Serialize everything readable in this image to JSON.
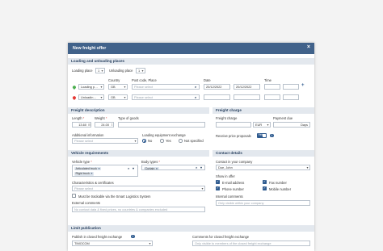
{
  "dialog": {
    "title": "New freight offer"
  },
  "loading": {
    "section": "Loading and unloading places",
    "loading_place_label": "Loading place",
    "loading_place_count": "1",
    "unloading_place_label": "Unloading place",
    "unloading_place_count": "1",
    "col_country": "Country",
    "col_postcode": "Post code, Place",
    "col_date": "Date",
    "col_time": "Time",
    "row1": {
      "type": "Loading p…",
      "country": "GB",
      "place": "Please select",
      "date_from": "20/12/2022",
      "date_to": "20/12/2022",
      "time_from": "",
      "time_to": "",
      "pin_color": "#4caf50"
    },
    "row2": {
      "type": "Unloadin…",
      "country": "GB",
      "place": "Please select",
      "date_from": "",
      "date_to": "",
      "time_from": "",
      "time_to": "",
      "pin_color": "#e53935"
    }
  },
  "freight_description": {
    "section": "Freight description",
    "length_label": "Length",
    "length_value": "13.60",
    "length_unit": "m",
    "weight_label": "Weight",
    "weight_value": "24.00",
    "weight_unit": "t",
    "goods_label": "Type of goods",
    "goods_value": "",
    "additional_label": "Additional information",
    "additional_placeholder": "Please select",
    "equipment_label": "Loading equipment exchange",
    "equipment_options": [
      "No",
      "Yes",
      "Not specified"
    ],
    "equipment_selected": "No"
  },
  "freight_charge": {
    "section": "Freight charge",
    "charge_label": "Freight charge",
    "currency": "EUR",
    "payment_due_label": "Payment due",
    "payment_due_unit": "Days",
    "receive_proposals_label": "Receive price proposals",
    "receive_proposals_value": "Yes"
  },
  "vehicle": {
    "section": "Vehicle requirements",
    "vehicle_type_label": "Vehicle type",
    "vehicle_types": [
      "Articulated truck",
      "Rigid truck"
    ],
    "body_type_label": "Body types",
    "body_types": [
      "Curtain"
    ],
    "characteristics_label": "Characteristics & certificates",
    "characteristics_placeholder": "Please select",
    "not_trackable_label": "Must be trackable via the Smart Logistics System",
    "external_comments_label": "External comments",
    "external_comments_placeholder": "No contact data & fixed prices, no countries & companies excluded"
  },
  "contact": {
    "section": "Contact details",
    "contact_label": "Contact in your company",
    "contact_value": "Doe, John",
    "show_in_offer_label": "Show in offer",
    "options": [
      {
        "label": "E-mail address",
        "checked": true
      },
      {
        "label": "Fax number",
        "checked": true
      },
      {
        "label": "Phone number",
        "checked": true
      },
      {
        "label": "Mobile number",
        "checked": true
      }
    ],
    "internal_comments_label": "Internal comments",
    "internal_comments_placeholder": "Only visible within your company"
  },
  "limit": {
    "section": "Limit publication",
    "publish_label": "Publish in closed freight exchange",
    "publish_value": "TIMOCOM",
    "comments_label": "Comments for closed freight exchange",
    "comments_placeholder": "Only visible to members of the closed freight exchange"
  },
  "colors": {
    "header": "#41628a",
    "section_bg": "#e3e8ee",
    "accent": "#2f5b8f",
    "page_bg": "#f3f3f3"
  }
}
